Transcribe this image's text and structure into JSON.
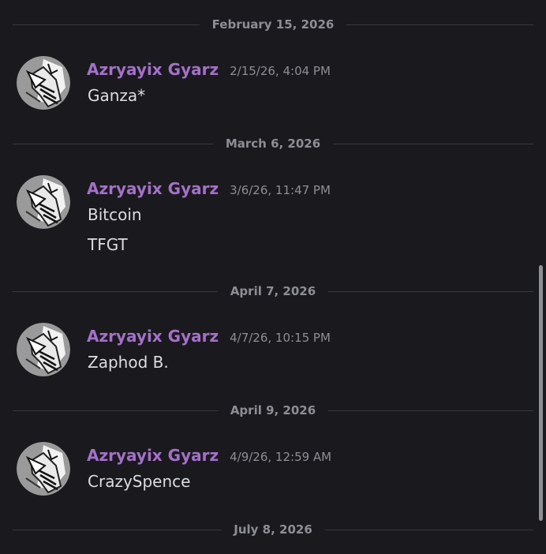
{
  "dividers": [
    {
      "date": "February 15, 2026"
    },
    {
      "date": "March 6, 2026"
    },
    {
      "date": "April 7, 2026"
    },
    {
      "date": "April 9, 2026"
    },
    {
      "date": "July 8, 2026"
    }
  ],
  "messages": [
    {
      "author": "Azryayix Gyarz",
      "timestamp": "2/15/26, 4:04 PM",
      "lines": [
        "Ganza*"
      ]
    },
    {
      "author": "Azryayix Gyarz",
      "timestamp": "3/6/26, 11:47 PM",
      "lines": [
        "Bitcoin",
        "TFGT"
      ]
    },
    {
      "author": "Azryayix Gyarz",
      "timestamp": "4/7/26, 10:15 PM",
      "lines": [
        "Zaphod B."
      ]
    },
    {
      "author": "Azryayix Gyarz",
      "timestamp": "4/9/26, 12:59 AM",
      "lines": [
        "CrazySpence"
      ]
    }
  ],
  "colors": {
    "background": "#1a1a1e",
    "author": "#a470c9",
    "muted": "#8d8e95",
    "text": "#dcdde0"
  },
  "icons": {
    "avatar": "abstract-bird-sketch-avatar"
  }
}
